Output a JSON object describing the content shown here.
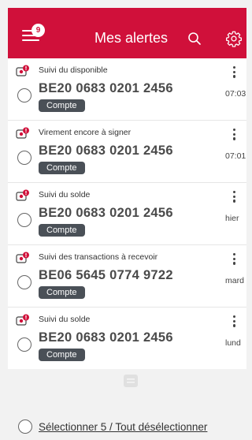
{
  "header": {
    "title": "Mes alertes",
    "menu_badge": "9",
    "menu_icon": "menu-icon",
    "search_icon": "search-icon",
    "settings_icon": "gear-icon",
    "brand_color": "#d0103a"
  },
  "alerts": [
    {
      "title": "Suivi du disponible",
      "account": "BE20 0683 0201 2456",
      "tag": "Compte",
      "time": "07:03",
      "selected": false
    },
    {
      "title": "Virement encore à signer",
      "account": "BE20 0683 0201 2456",
      "tag": "Compte",
      "time": "07:01",
      "selected": false
    },
    {
      "title": "Suivi du solde",
      "account": "BE20 0683 0201 2456",
      "tag": "Compte",
      "time": "hier",
      "selected": false
    },
    {
      "title": "Suivi des transactions à recevoir",
      "account": "BE06 5645 0774 9722",
      "tag": "Compte",
      "time": "mard",
      "selected": false
    },
    {
      "title": "Suivi du solde",
      "account": "BE20 0683 0201 2456",
      "tag": "Compte",
      "time": "lund",
      "selected": false
    }
  ],
  "footer": {
    "select_label": "Sélectionner 5 / Tout désélectionner"
  }
}
